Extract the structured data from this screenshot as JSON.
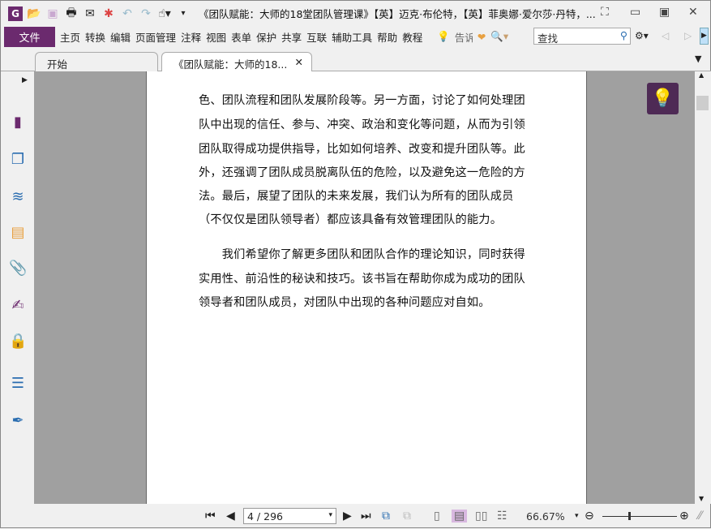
{
  "titlebar": {
    "logo": "G",
    "title": "《团队赋能：大师的18堂团队管理课》【英】迈克·布伦特，【英】菲奥娜·爱尔莎·丹特，..."
  },
  "menu": {
    "file": "文件",
    "items": [
      "主页",
      "转换",
      "编辑",
      "页面管理",
      "注释",
      "视图",
      "表单",
      "保护",
      "共享",
      "互联",
      "辅助工具",
      "帮助",
      "教程"
    ],
    "tell": "告诉",
    "search_placeholder": "查找"
  },
  "tabs": [
    {
      "label": "开始"
    },
    {
      "label": "《团队赋能：大师的18...",
      "close": "✕"
    }
  ],
  "document": {
    "lines": [
      "色、团队流程和团队发展阶段等。另一方面，讨论了如何处理团",
      "队中出现的信任、参与、冲突、政治和变化等问题，从而为引领",
      "团队取得成功提供指导，比如如何培养、改变和提升团队等。此",
      "外，还强调了团队成员脱离队伍的危险，以及避免这一危险的方",
      "法。最后，展望了团队的未来发展，我们认为所有的团队成员",
      "（不仅仅是团队领导者）都应该具备有效管理团队的能力。",
      "　　我们希望你了解更多团队和团队合作的理论知识，同时获得",
      "实用性、前沿性的秘诀和技巧。该书旨在帮助你成为成功的团队",
      "领导者和团队成员，对团队中出现的各种问题应对自如。"
    ]
  },
  "status": {
    "page": "4 / 296",
    "zoom": "66.67%",
    "zoom_level_fraction": 0.35
  },
  "colors": {
    "accent": "#6b2a6e"
  }
}
